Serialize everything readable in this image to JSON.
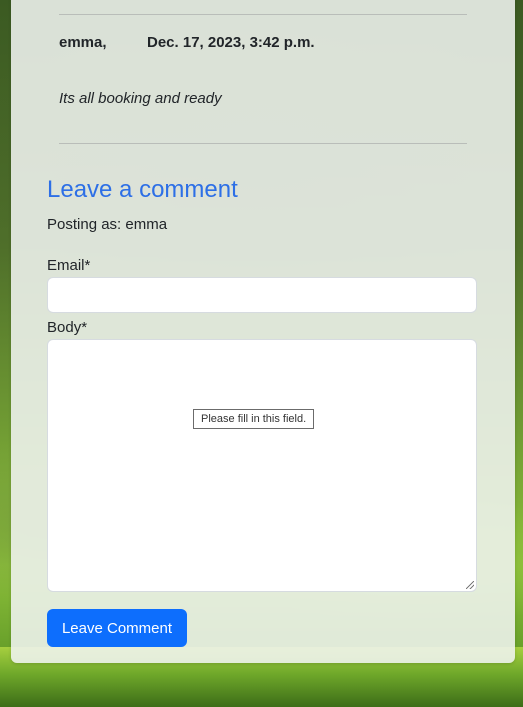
{
  "comment": {
    "author": "emma,",
    "date": "Dec. 17, 2023, 3:42 p.m.",
    "body": "Its all booking and ready"
  },
  "form": {
    "title": "Leave a comment",
    "posting_as": "Posting as: emma",
    "email_label": "Email*",
    "email_value": "",
    "body_label": "Body*",
    "body_value": "",
    "validation_tooltip": "Please fill in this field.",
    "submit_label": "Leave Comment"
  },
  "colors": {
    "accent": "#0d6efd",
    "title": "#2d6fe6"
  }
}
